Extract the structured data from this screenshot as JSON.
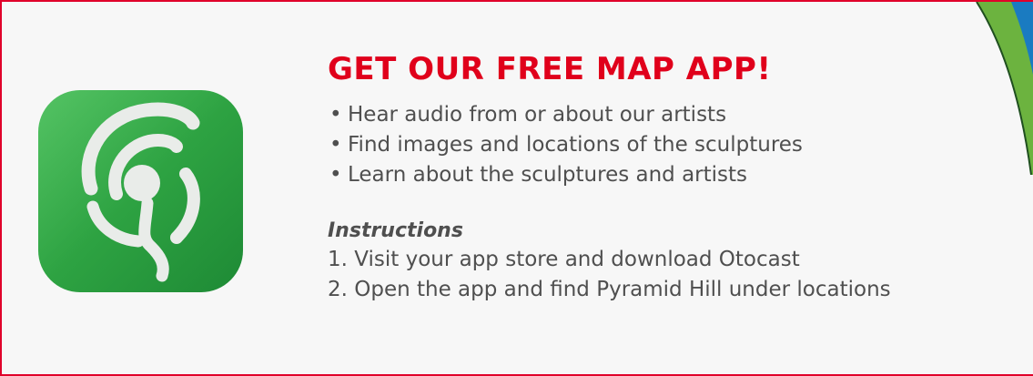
{
  "headline": "GET OUR FREE MAP APP!",
  "features": [
    "Hear audio from or about our artists",
    "Find images and locations of the sculptures",
    "Learn about the sculptures and artists"
  ],
  "bullet": "•",
  "instructions": {
    "heading": "Instructions",
    "steps": [
      "1. Visit your app store and download Otocast",
      "2. Open the app and find Pyramid Hill under locations"
    ]
  },
  "colors": {
    "headline": "#e0001b",
    "border": "#e0002a",
    "body_text": "#4f4f4f",
    "icon_green": "#2e9e3f",
    "swoosh_green": "#6cb33f",
    "swoosh_blue": "#1a7bc1"
  },
  "icons": {
    "app": "otocast-app-icon",
    "decoration": "green-swoosh-decoration"
  }
}
